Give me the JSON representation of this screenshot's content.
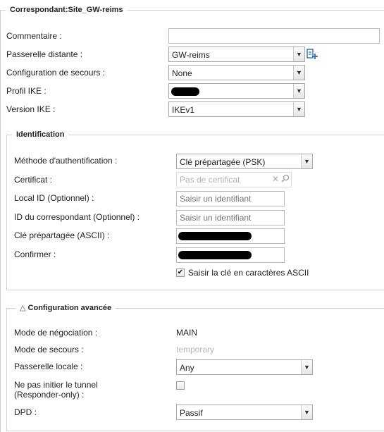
{
  "main": {
    "legend": "Correspondant:Site_GW-reims",
    "labels": {
      "commentaire": "Commentaire :",
      "passerelle_distante": "Passerelle distante :",
      "configuration_secours": "Configuration de secours :",
      "profil_ike": "Profil IKE :",
      "version_ike": "Version IKE :"
    },
    "values": {
      "commentaire": "",
      "passerelle_distante": "GW-reims",
      "configuration_secours": "None",
      "version_ike": "IKEv1"
    }
  },
  "identification": {
    "legend": "Identification",
    "labels": {
      "methode": "Méthode d'authentification :",
      "certificat": "Certificat :",
      "local_id": "Local ID (Optionnel) :",
      "id_correspondant": "ID du correspondant (Optionnel) :",
      "cle": "Clé prépartagée (ASCII) :",
      "confirmer": "Confirmer :"
    },
    "values": {
      "methode": "Clé prépartagée (PSK)"
    },
    "placeholders": {
      "certificat": "Pas de certificat",
      "local_id": "Saisir un identifiant",
      "id_correspondant": "Saisir un identifiant"
    },
    "ascii_checkbox": {
      "label": "Saisir la clé en caractères ASCII",
      "checked": true
    }
  },
  "advanced": {
    "legend": "Configuration avancée",
    "labels": {
      "mode_negociation": "Mode de négociation :",
      "mode_secours": "Mode de secours :",
      "passerelle_locale": "Passerelle locale :",
      "responder_line1": "Ne pas initier le tunnel",
      "responder_line2": "(Responder-only) :",
      "dpd": "DPD :"
    },
    "values": {
      "mode_negociation": "MAIN",
      "mode_secours": "temporary",
      "passerelle_locale": "Any",
      "dpd": "Passif"
    },
    "responder_checked": false
  },
  "icons": {
    "dropdown": "chevron-down-icon",
    "add": "add-object-icon",
    "clear": "close-icon",
    "search": "search-icon",
    "collapse": "collapse-triangle-icon",
    "check": "checkmark-icon"
  },
  "colors": {
    "border": "#cfcfcf",
    "muted": "#b5b5b5",
    "add_icon": "#2f6fb8"
  }
}
